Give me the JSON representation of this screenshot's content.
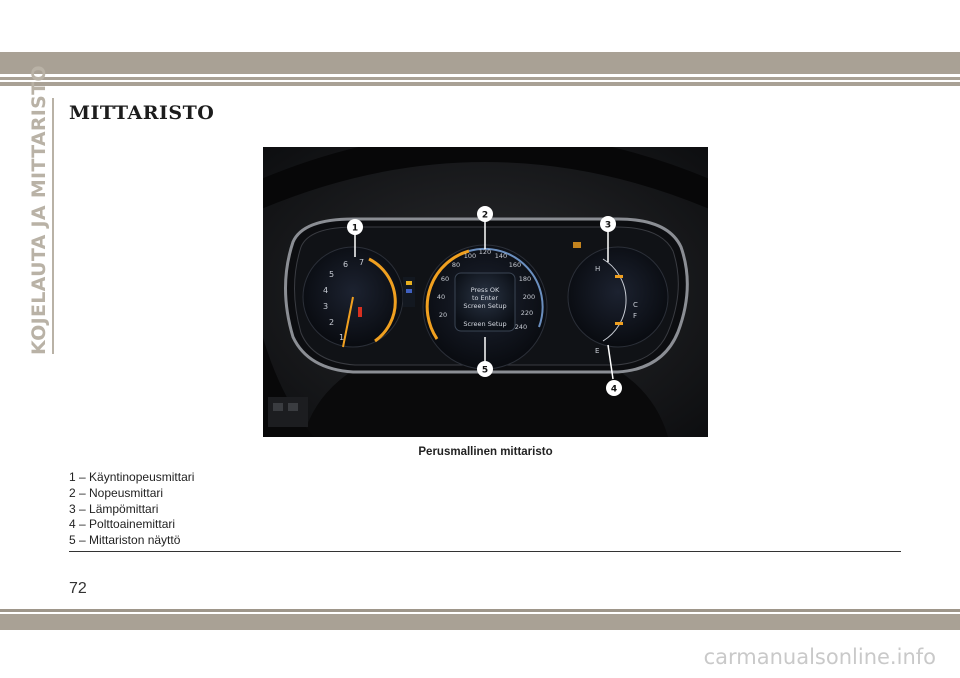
{
  "side_tab": {
    "label": "KOJELAUTA JA MITTARISTO"
  },
  "section": {
    "title": "MITTARISTO"
  },
  "figure": {
    "caption": "Perusmallinen mittaristo",
    "callouts": [
      "1",
      "2",
      "3",
      "4",
      "5"
    ],
    "display_text": [
      "Press OK",
      "to Enter",
      "Screen Setup"
    ],
    "display_footer": "Screen Setup",
    "speed_ticks": [
      "20",
      "40",
      "60",
      "80",
      "100",
      "120",
      "140",
      "160",
      "180",
      "200",
      "220",
      "240"
    ],
    "tacho_ticks": [
      "1",
      "2",
      "3",
      "4",
      "5",
      "6",
      "7"
    ],
    "gauge_marks": {
      "temp_high": "H",
      "temp_low": "C",
      "fuel_full": "F",
      "fuel_empty": "E"
    }
  },
  "legend": [
    "1 – Käyntinopeusmittari",
    "2 – Nopeusmittari",
    "3 – Lämpömittari",
    "4 – Polttoainemittari",
    "5 – Mittariston näyttö"
  ],
  "page": {
    "number": "72"
  },
  "watermark": {
    "text": "carmanualsonline.info"
  },
  "colors": {
    "band": "#a9a195",
    "side_tab": "#b9b2a6",
    "needle": "#f0a020",
    "callout": "#ffffff"
  }
}
